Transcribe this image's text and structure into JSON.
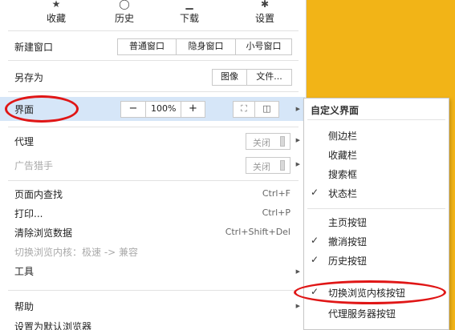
{
  "top_icons": [
    {
      "name": "favorites",
      "icon": "star-icon",
      "glyph": "★",
      "label": "收藏"
    },
    {
      "name": "history",
      "icon": "clock-icon",
      "glyph": "◯",
      "label": "历史"
    },
    {
      "name": "download",
      "icon": "download-icon",
      "glyph": "▁",
      "label": "下载"
    },
    {
      "name": "settings",
      "icon": "gear-icon",
      "glyph": "✱",
      "label": "设置"
    }
  ],
  "menu": {
    "new_window": {
      "label": "新建窗口",
      "buttons": [
        "普通窗口",
        "隐身窗口",
        "小号窗口"
      ]
    },
    "save_as": {
      "label": "另存为",
      "buttons": [
        "图像",
        "文件..."
      ]
    },
    "interface": {
      "label": "界面",
      "zoom_out": "−",
      "zoom": "100%",
      "zoom_in": "+",
      "fullscreen_glyph": "⛶",
      "layout_glyph": "◫",
      "arrow": "▶"
    },
    "proxy": {
      "label": "代理",
      "toggle": "关闭",
      "arrow": "▶"
    },
    "adblock": {
      "label": "广告猎手",
      "toggle": "关闭",
      "arrow": "▶"
    },
    "find": {
      "label": "页面内查找",
      "shortcut": "Ctrl+F"
    },
    "print": {
      "label": "打印...",
      "shortcut": "Ctrl+P"
    },
    "clear": {
      "label": "清除浏览数据",
      "shortcut": "Ctrl+Shift+Del"
    },
    "switch_core": {
      "label": "切换浏览内核：极速 -> 兼容"
    },
    "tools": {
      "label": "工具",
      "arrow": "▶"
    },
    "help": {
      "label": "帮助",
      "arrow": "▶"
    },
    "default_browser": {
      "label": "设置为默认浏览器"
    }
  },
  "submenu": {
    "title": "自定义界面",
    "check_glyph": "✓",
    "items": [
      {
        "label": "侧边栏",
        "checked": false
      },
      {
        "label": "收藏栏",
        "checked": false
      },
      {
        "label": "搜索框",
        "checked": false
      },
      {
        "label": "状态栏",
        "checked": true
      },
      {
        "label": "主页按钮",
        "checked": false
      },
      {
        "label": "撤消按钮",
        "checked": true
      },
      {
        "label": "历史按钮",
        "checked": true
      },
      {
        "label": "切换浏览内核按钮",
        "checked": true
      },
      {
        "label": "代理服务器按钮",
        "checked": false
      }
    ]
  },
  "colors": {
    "highlight": "#d6e6f8",
    "annotation_red": "#e01616",
    "background_yellow": "#f2b417"
  }
}
